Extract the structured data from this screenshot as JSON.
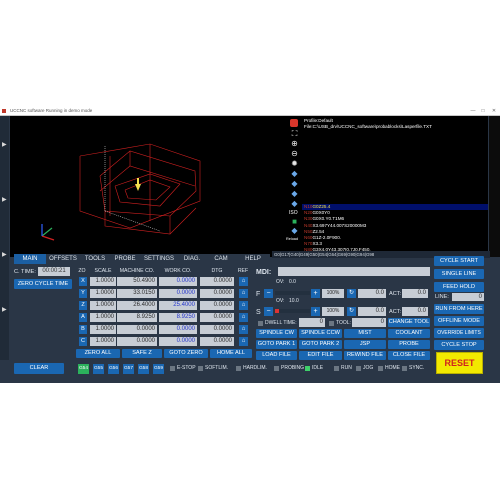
{
  "window": {
    "title": "UCCNC software Running in demo mode",
    "minimize_glyph": "—",
    "maximize_glyph": "□",
    "close_glyph": "✕"
  },
  "profile": {
    "line1": "Profile:Default",
    "line2": "File:C:\\USB_drv\\UCCNC_software\\probablocks\\Lasperfile.TXT"
  },
  "side_icons": [
    "fullscreen-icon",
    "zoom-in-icon",
    "zoom-out-icon",
    "light-icon",
    "cube-icon",
    "cube-icon",
    "cube-icon",
    "cube-icon"
  ],
  "side_labels": {
    "iso": "ISO",
    "reload": "Reload"
  },
  "gcode": [
    {
      "n": "N10",
      "code": "G0Z25.4",
      "current": true
    },
    {
      "n": "N20",
      "code": "G0X0Y0",
      "current": false
    },
    {
      "n": "N30",
      "code": "G0X0.Y0.T1M6",
      "current": false
    },
    {
      "n": "N40",
      "code": "X3.697Y44.007S20000M3",
      "current": false
    },
    {
      "n": "N50",
      "code": "Z2.54",
      "current": false
    },
    {
      "n": "N60",
      "code": "G1Z-2.0F900.",
      "current": false
    },
    {
      "n": "N70",
      "code": "X3.3",
      "current": false
    },
    {
      "n": "N80",
      "code": "G3X4.0Y43.307I0.7J0.F450.",
      "current": false
    },
    {
      "n": "N90",
      "code": "G1X8.0F900.",
      "current": false
    }
  ],
  "modal_codes": "G0|G17|G40|G49|G50|G54|G64|G69|G90|G94|G98",
  "tabs": [
    "MAIN",
    "OFFSETS",
    "TOOLS",
    "PROBE",
    "SETTINGS",
    "DIAG.",
    "CAM",
    "HELP"
  ],
  "cycle": {
    "ctime_label": "C. TIME:",
    "ctime_value": "00:00:21",
    "zero_cycle_time": "ZERO CYCLE TIME",
    "clear": "CLEAR"
  },
  "dro": {
    "headers": [
      "ZO",
      "SCALE",
      "MACHINE CO.",
      "WORK CO.",
      "DTG",
      "REF"
    ],
    "rows": [
      {
        "axis": "X",
        "scale": "1.0000",
        "machine": "50.4900",
        "work": "0.0000",
        "dtg": "0.0000"
      },
      {
        "axis": "Y",
        "scale": "1.0000",
        "machine": "33.0150",
        "work": "0.0000",
        "dtg": "0.0000"
      },
      {
        "axis": "Z",
        "scale": "1.0000",
        "machine": "26.4000",
        "work": "25.4000",
        "dtg": "0.0000"
      },
      {
        "axis": "A",
        "scale": "1.0000",
        "machine": "8.9250",
        "work": "8.9250",
        "dtg": "0.0000"
      },
      {
        "axis": "B",
        "scale": "1.0000",
        "machine": "0.0000",
        "work": "0.0000",
        "dtg": "0.0000"
      },
      {
        "axis": "C",
        "scale": "1.0000",
        "machine": "0.0000",
        "work": "0.0000",
        "dtg": "0.0000"
      }
    ],
    "ref_icon": "home-icon",
    "buttons": [
      "ZERO ALL",
      "SAFE Z",
      "GOTO ZERO",
      "HOME ALL"
    ]
  },
  "work_offsets": [
    {
      "label": "G54",
      "active": true
    },
    {
      "label": "G55",
      "active": false
    },
    {
      "label": "G56",
      "active": false
    },
    {
      "label": "G57",
      "active": false
    },
    {
      "label": "G58",
      "active": false
    },
    {
      "label": "G59",
      "active": false
    }
  ],
  "status": [
    "E-STOP",
    "SOFTLIM.",
    "HARDLIM.",
    "PROBING",
    "IDLE",
    "RUN",
    "JOG",
    "HOME",
    "SYNC."
  ],
  "status_active": "IDLE",
  "mdi": {
    "label": "MDI:",
    "value": ""
  },
  "feed": {
    "label": "F",
    "ov_label": "OV:",
    "ov_value": "0.0",
    "ov_level": 0,
    "pct": "100%",
    "set": "0.0",
    "act_label": "ACT:",
    "act": "0.0"
  },
  "spindle": {
    "label": "S",
    "ov_label": "OV:",
    "ov_value": "10.0",
    "ov_level": 0.1,
    "pct": "100%",
    "set": "0.0",
    "act_label": "ACT:",
    "act": "0.0"
  },
  "dwell": {
    "label": "DWELL TIME:",
    "value": "0",
    "tool_label": "TOOL:",
    "tool_value": "0",
    "change_tool": "CHANGE TOOL"
  },
  "mid_buttons": [
    [
      "SPINDLE CW",
      "SPINDLE CCW",
      "MIST",
      "COOLANT"
    ],
    [
      "GOTO PARK 1",
      "GOTO PARK 2",
      "JSP",
      "PROBE"
    ],
    [
      "LOAD FILE",
      "EDIT FILE",
      "REWIND FILE",
      "CLOSE FILE"
    ]
  ],
  "right": {
    "cycle_start": "CYCLE START",
    "single_line": "SINGLE LINE",
    "feed_hold": "FEED HOLD",
    "line_label": "LINE:",
    "line_value": "0",
    "run_from_here": "RUN FROM HERE",
    "offline_mode": "OFFLINE MODE",
    "override_limits": "OVERRIDE LIMITS",
    "cycle_stop": "CYCLE STOP",
    "reset": "RESET"
  },
  "colors": {
    "panel": "#2a3646",
    "button": "#1a67b2",
    "active": "#2bb15c",
    "reset": "#f2e900",
    "toolpath": "#d02020"
  }
}
